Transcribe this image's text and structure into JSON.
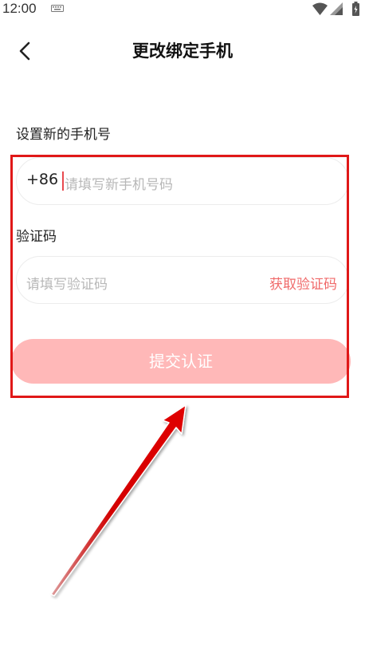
{
  "status_bar": {
    "time": "12:00",
    "icons": [
      "keyboard-icon",
      "wifi-icon",
      "signal-icon",
      "battery-icon"
    ]
  },
  "header": {
    "back_icon": "chevron-left-icon",
    "title": "更改绑定手机"
  },
  "phone_section": {
    "label": "设置新的手机号",
    "country_code": "+86",
    "placeholder": "请填写新手机号码"
  },
  "code_section": {
    "label": "验证码",
    "placeholder": "请填写验证码",
    "get_code_label": "获取验证码"
  },
  "submit_label": "提交认证",
  "colors": {
    "accent": "#f06a6a",
    "submit_bg": "#ffb8b8",
    "annotation": "#e01818"
  }
}
